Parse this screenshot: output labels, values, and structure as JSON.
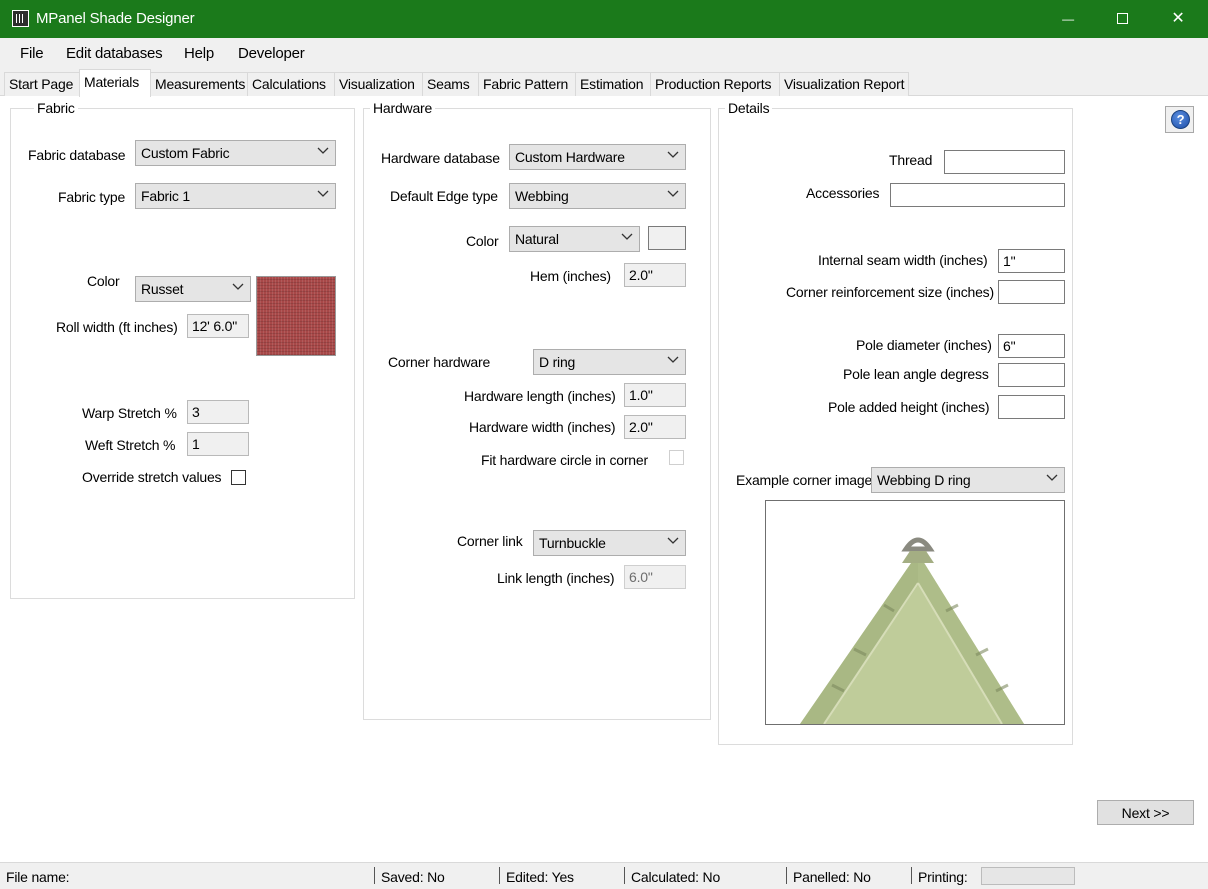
{
  "window": {
    "title": "MPanel Shade Designer",
    "minimize": "—",
    "close": "✕"
  },
  "menu": [
    "File",
    "Edit databases",
    "Help",
    "Developer"
  ],
  "tabs": [
    "Start Page",
    "Materials",
    "Measurements",
    "Calculations",
    "Visualization",
    "Seams",
    "Fabric Pattern",
    "Estimation",
    "Production Reports",
    "Visualization Report"
  ],
  "active_tab": "Materials",
  "fabric": {
    "group_title": "Fabric",
    "database_label": "Fabric database",
    "database_value": "Custom Fabric",
    "type_label": "Fabric type",
    "type_value": "Fabric 1",
    "color_label": "Color",
    "color_value": "Russet",
    "swatch_color": "#a84848",
    "roll_width_label": "Roll width (ft inches)",
    "roll_width_value": "12' 6.0\"",
    "warp_label": "Warp Stretch %",
    "warp_value": "3",
    "weft_label": "Weft Stretch %",
    "weft_value": "1",
    "override_label": "Override stretch values",
    "override_checked": false
  },
  "hardware": {
    "group_title": "Hardware",
    "database_label": "Hardware database",
    "database_value": "Custom Hardware",
    "edge_label": "Default Edge type",
    "edge_value": "Webbing",
    "color_label": "Color",
    "color_value": "Natural",
    "hem_label": "Hem (inches)",
    "hem_value": "2.0\"",
    "corner_label": "Corner hardware",
    "corner_value": "D ring",
    "length_label": "Hardware length (inches)",
    "length_value": "1.0\"",
    "width_label": "Hardware width (inches)",
    "width_value": "2.0\"",
    "fit_label": "Fit hardware circle in corner",
    "link_label": "Corner link",
    "link_value": "Turnbuckle",
    "link_length_label": "Link length (inches)",
    "link_length_value": "6.0\""
  },
  "details": {
    "group_title": "Details",
    "thread_label": "Thread",
    "thread_value": "",
    "accessories_label": "Accessories",
    "accessories_value": "",
    "seam_label": "Internal seam width  (inches)",
    "seam_value": "1\"",
    "reinforce_label": "Corner reinforcement size (inches)",
    "reinforce_value": "",
    "pole_diameter_label": "Pole diameter (inches)",
    "pole_diameter_value": "6\"",
    "pole_lean_label": "Pole lean angle degress",
    "pole_lean_value": "",
    "pole_height_label": "Pole added height (inches)",
    "pole_height_value": "",
    "example_label": "Example corner image",
    "example_value": "Webbing D ring"
  },
  "help_symbol": "?",
  "next_button": "Next  >>",
  "status": {
    "file_name": "File name:",
    "saved": "Saved: No",
    "edited": "Edited: Yes",
    "calculated": "Calculated: No",
    "panelled": "Panelled: No",
    "printing": "Printing:"
  }
}
